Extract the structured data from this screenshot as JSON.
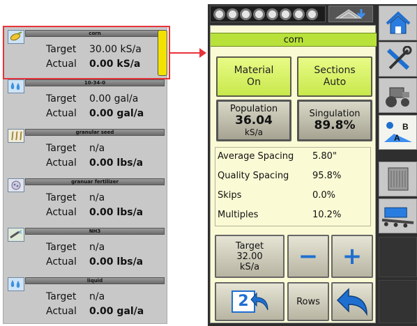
{
  "products": [
    {
      "name": "corn",
      "target_label": "Target",
      "target_value": "30.00 kS/a",
      "actual_label": "Actual",
      "actual_value": "0.00 kS/a",
      "icon": "corn-seed-icon"
    },
    {
      "name": "10-34-0",
      "target_label": "Target",
      "target_value": "0.00 gal/a",
      "actual_label": "Actual",
      "actual_value": "0.00 gal/a",
      "icon": "liquid-drops-icon"
    },
    {
      "name": "granular seed",
      "target_label": "Target",
      "target_value": "n/a",
      "actual_label": "Actual",
      "actual_value": "0.00 lbs/a",
      "icon": "granular-seed-icon"
    },
    {
      "name": "granuar fertilizer",
      "target_label": "Target",
      "target_value": "n/a",
      "actual_label": "Actual",
      "actual_value": "0.00 lbs/a",
      "icon": "granular-fertilizer-icon"
    },
    {
      "name": "NH3",
      "target_label": "Target",
      "target_value": "n/a",
      "actual_label": "Actual",
      "actual_value": "0.00 lbs/a",
      "icon": "nh3-nozzle-icon"
    },
    {
      "name": "liquid",
      "target_label": "Target",
      "target_value": "n/a",
      "actual_label": "Actual",
      "actual_value": "0.00 gal/a",
      "icon": "liquid-drops-icon"
    }
  ],
  "panel": {
    "title": "corn",
    "material_line1": "Material",
    "material_line2": "On",
    "sections_line1": "Sections",
    "sections_line2": "Auto",
    "population_label": "Population",
    "population_value": "36.04",
    "population_unit": "kS/a",
    "singulation_label": "Singulation",
    "singulation_value": "89.8%",
    "stats": [
      {
        "label": "Average Spacing",
        "value": "5.80\""
      },
      {
        "label": "Quality Spacing",
        "value": "95.8%"
      },
      {
        "label": "Skips",
        "value": "0.0%"
      },
      {
        "label": "Multiples",
        "value": "10.2%"
      }
    ],
    "target_label": "Target",
    "target_value": "32.00",
    "target_unit": "kS/a",
    "minus_label": "−",
    "plus_label": "+",
    "page_number": "2",
    "rows_label": "Rows"
  },
  "status_dots": 8,
  "side_nav_icons": [
    "home-icon",
    "tools-icon",
    "tractor-icon",
    "ab-guidance-icon",
    "radiator-icon",
    "planter-icon"
  ],
  "colors": {
    "highlight_red": "#e8323a",
    "title_green": "#b8e23a",
    "button_green": "#d4ef5e",
    "panel_bg": "#fafad5",
    "selection_yellow": "#f3e100",
    "action_blue": "#1f6fd0"
  }
}
